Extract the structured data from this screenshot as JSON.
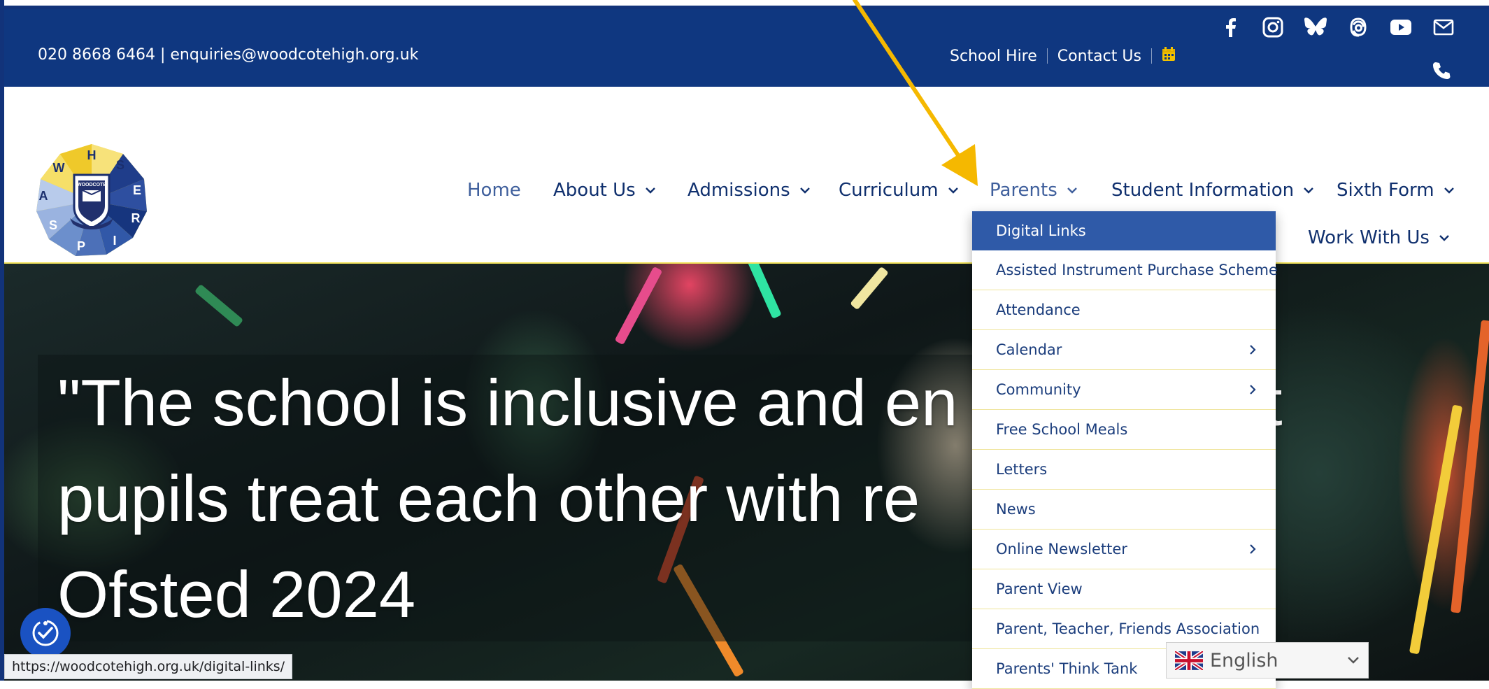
{
  "topbar": {
    "contact": "020 8668 6464 | enquiries@woodcotehigh.org.uk",
    "links": [
      "School Hire",
      "Contact Us"
    ]
  },
  "social": [
    "facebook-icon",
    "instagram-icon",
    "bluesky-icon",
    "threads-icon",
    "youtube-icon",
    "mail-icon",
    "phone-icon"
  ],
  "logo": {
    "letters": [
      "H",
      "S",
      "E",
      "R",
      "I",
      "P",
      "S",
      "A",
      "W"
    ],
    "crest": "WOODCOTE"
  },
  "nav": {
    "items": [
      "Home",
      "About Us",
      "Admissions",
      "Curriculum",
      "Parents",
      "Student Information",
      "Sixth Form",
      "Work With Us"
    ]
  },
  "dropdown": {
    "items": [
      {
        "label": "Digital Links"
      },
      {
        "label": "Assisted Instrument Purchase Scheme"
      },
      {
        "label": "Attendance"
      },
      {
        "label": "Calendar"
      },
      {
        "label": "Community"
      },
      {
        "label": "Free School Meals"
      },
      {
        "label": "Letters"
      },
      {
        "label": "News"
      },
      {
        "label": "Online Newsletter"
      },
      {
        "label": "Parent View"
      },
      {
        "label": "Parent, Teacher, Friends Association"
      },
      {
        "label": "Parents' Think Tank"
      }
    ]
  },
  "hero": {
    "line1": "\"The school is inclusive and en",
    "line1_end": "t",
    "line2": "pupils treat each other with re",
    "line3": "Ofsted 2024"
  },
  "status": {
    "url": "https://woodcotehigh.org.uk/digital-links/"
  },
  "language": {
    "selected": "English"
  },
  "colors": {
    "brand_navy": "#0f3780",
    "menu_active": "#2f5aa8",
    "accent_yellow": "#f2e35a",
    "arrow": "#f5b800"
  }
}
